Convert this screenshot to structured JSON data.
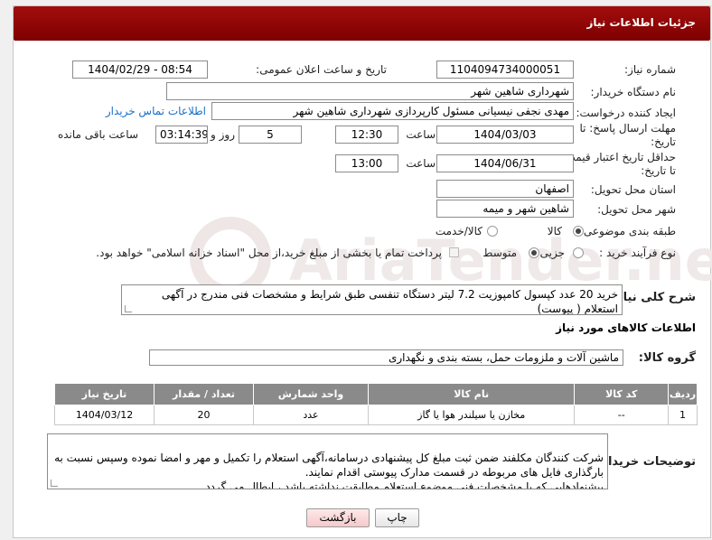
{
  "header": {
    "title": "جزئیات اطلاعات نیاز"
  },
  "fields": {
    "need_number_label": "شماره نیاز:",
    "need_number": "1104094734000051",
    "announce_label": "تاریخ و ساعت اعلان عمومی:",
    "announce_value": "1404/02/29 - 08:54",
    "buyer_label": "نام دستگاه خریدار:",
    "buyer_value": "شهرداری شاهین شهر",
    "creator_label": "ایجاد کننده درخواست:",
    "creator_value": "مهدی نجفی نیسیانی مسئول کارپردازی شهرداری شاهین شهر",
    "contact_link": "اطلاعات تماس خریدار",
    "deadline_label_1": "مهلت ارسال پاسخ: تا",
    "deadline_label_2": "تاریخ:",
    "deadline_date": "1404/03/03",
    "time_label": "ساعت",
    "deadline_time": "12:30",
    "days_value": "5",
    "days_label": "روز و",
    "remaining_time": "03:14:39",
    "remaining_label": "ساعت باقی مانده",
    "validity_label_1": "حداقل تاریخ اعتبار قیمت:",
    "validity_label_2": "تا تاریخ:",
    "validity_date": "1404/06/31",
    "validity_time": "13:00",
    "province_label": "استان محل تحویل:",
    "province_value": "اصفهان",
    "city_label": "شهر محل تحویل:",
    "city_value": "شاهین شهر و میمه",
    "category_label": "طبقه بندی موضوعی:",
    "category_options": [
      "کالا",
      "کالا/خدمت"
    ],
    "process_label": "نوع فرآیند خرید :",
    "process_options": [
      "جزیی",
      "متوسط"
    ],
    "payment_note": "پرداخت تمام یا بخشی از مبلغ خرید،از محل \"اسناد خزانه اسلامی\" خواهد بود."
  },
  "description": {
    "label": "شرح کلی نیاز:",
    "text": "خرید 20 عدد کپسول کامپوزیت 7.2 لیتر دستگاه تنفسی طبق شرایط و مشخصات فنی مندرج در آگهی استعلام ( پیوست)"
  },
  "goods": {
    "section_title": "اطلاعات کالاهای مورد نیاز",
    "group_label": "گروه کالا:",
    "group_value": "ماشین آلات و ملزومات حمل، بسته بندی و نگهداری"
  },
  "table": {
    "headers": [
      "ردیف",
      "کد کالا",
      "نام کالا",
      "واحد شمارش",
      "تعداد / مقدار",
      "تاریخ نیاز"
    ],
    "rows": [
      [
        "1",
        "--",
        "مخازن یا سیلندر هوا یا گاز",
        "عدد",
        "20",
        "1404/03/12"
      ]
    ]
  },
  "buyer_notes": {
    "label": "توضیحات خریدار:",
    "text": "شرکت کنندگان مکلفند ضمن ثبت مبلغ کل پیشنهادی درسامانه،آگهی استعلام را  تکمیل و مهر و امضا نموده وسپس نسبت به بارگذاری فایل های مربوطه در قسمت مدارک پیوستی اقدام نمایند.\nپیشنهادهایی که با مشخصات فنی موضوع استعلام مطابقت نداشته باشد ، ابطال می گردد."
  },
  "buttons": {
    "print": "چاپ",
    "back": "بازگشت"
  }
}
